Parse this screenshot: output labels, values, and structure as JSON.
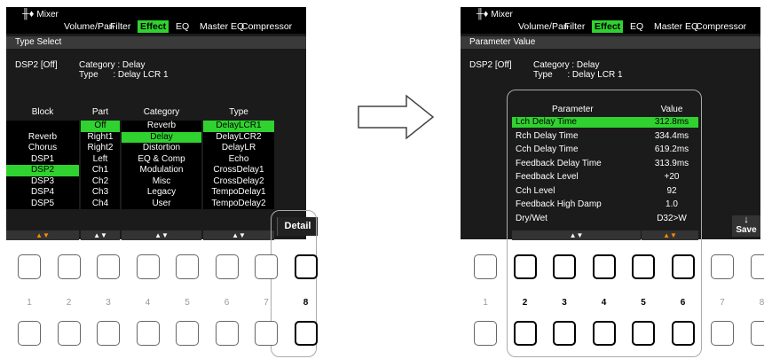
{
  "left_screen": {
    "title": "Mixer",
    "tabs": [
      {
        "label": "Volume/Pan",
        "active": false
      },
      {
        "label": "Filter",
        "active": false
      },
      {
        "label": "Effect",
        "active": true
      },
      {
        "label": "EQ",
        "active": false
      },
      {
        "label": "Master EQ",
        "active": false
      },
      {
        "label": "Compressor",
        "active": false
      }
    ],
    "section": "Type Select",
    "info": {
      "dsp": "DSP2 [Off]",
      "category_line": "Category : Delay",
      "type_line": "Type      : Delay LCR 1"
    },
    "columns": [
      {
        "header": "Block",
        "items": [
          "",
          "Reverb",
          "Chorus",
          "DSP1",
          "DSP2",
          "DSP3",
          "DSP4",
          "DSP5"
        ],
        "selected": 4,
        "arrows": "▲▼",
        "arrow_color": "orange"
      },
      {
        "header": "Part",
        "items": [
          "Off",
          "Right1",
          "Right2",
          "Left",
          "Ch1",
          "Ch2",
          "Ch3",
          "Ch4"
        ],
        "selected": 0,
        "arrows": "▲▼",
        "arrow_color": "white"
      },
      {
        "header": "Category",
        "items": [
          "Reverb",
          "Delay",
          "Distortion",
          "EQ & Comp",
          "Modulation",
          "Misc",
          "Legacy",
          "User"
        ],
        "selected": 1,
        "arrows": "▲▼",
        "arrow_color": "white"
      },
      {
        "header": "Type",
        "items": [
          "DelayLCR1",
          "DelayLCR2",
          "DelayLR",
          "Echo",
          "CrossDelay1",
          "CrossDelay2",
          "TempoDelay1",
          "TempoDelay2"
        ],
        "selected": 0,
        "arrows": "▲▼",
        "arrow_color": "white"
      }
    ],
    "detail_label": "Detail",
    "button_numbers": [
      "1",
      "2",
      "3",
      "4",
      "5",
      "6",
      "7",
      "8"
    ],
    "highlight_buttons": [
      8
    ]
  },
  "right_screen": {
    "title": "Mixer",
    "tabs": [
      {
        "label": "Volume/Pan",
        "active": false
      },
      {
        "label": "Filter",
        "active": false
      },
      {
        "label": "Effect",
        "active": true
      },
      {
        "label": "EQ",
        "active": false
      },
      {
        "label": "Master EQ",
        "active": false
      },
      {
        "label": "Compressor",
        "active": false
      }
    ],
    "section": "Parameter Value",
    "info": {
      "dsp": "DSP2 [Off]",
      "category_line": "Category : Delay",
      "type_line": "Type      : Delay LCR 1"
    },
    "param_header": "Parameter",
    "value_header": "Value",
    "params": [
      {
        "name": "Lch Delay Time",
        "value": "312.8ms"
      },
      {
        "name": "Rch Delay Time",
        "value": "334.4ms"
      },
      {
        "name": "Cch Delay Time",
        "value": "619.2ms"
      },
      {
        "name": "Feedback Delay Time",
        "value": "313.9ms"
      },
      {
        "name": "Feedback Level",
        "value": "+20"
      },
      {
        "name": "Cch Level",
        "value": "92"
      },
      {
        "name": "Feedback High Damp",
        "value": "1.0"
      },
      {
        "name": "Dry/Wet",
        "value": "D32>W"
      }
    ],
    "selected_param": 0,
    "param_arrows": "▲▼",
    "value_arrows": "▲▼",
    "save_label": "Save",
    "save_icon": "↓",
    "button_numbers": [
      "1",
      "2",
      "3",
      "4",
      "5",
      "6",
      "7",
      "8"
    ],
    "highlight_buttons": [
      2,
      3,
      4,
      5,
      6
    ]
  },
  "transition_arrow": "right-arrow-icon"
}
